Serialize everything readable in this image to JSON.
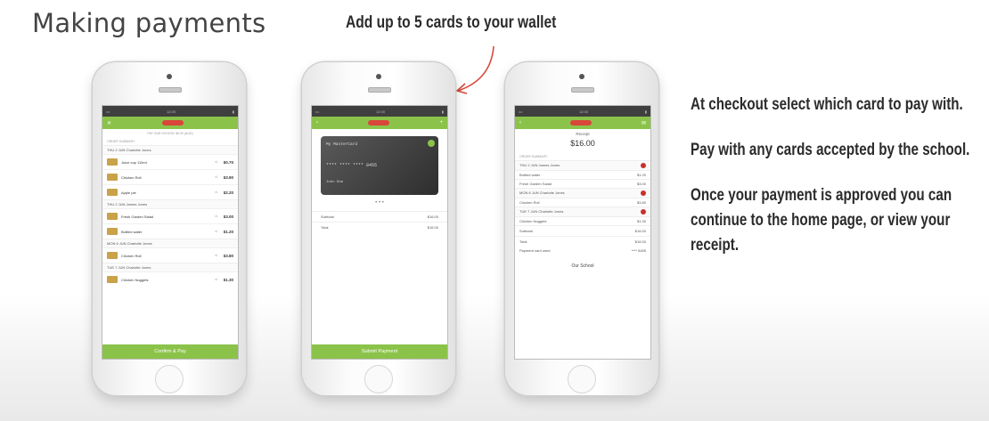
{
  "heading": "Making payments",
  "callout": "Add up to 5 cards to your wallet",
  "side_text": [
    "At checkout select which card to pay with.",
    "Pay with any cards accepted by the school.",
    "Once your payment is approved you can continue to the home page, or view your receipt."
  ],
  "phone1": {
    "subtitle": "PAY OUR SCHOOL $6.90 (AUD)",
    "section": "ORDER SUMMARY",
    "groups": [
      {
        "day": "THU 2 JUN  Charlotte Jones",
        "items": [
          {
            "name": "Juice cup 110ml",
            "qty": "x1",
            "price": "$0.70"
          },
          {
            "name": "Chicken Roll",
            "qty": "x1",
            "price": "$3.90"
          },
          {
            "name": "Apple pie",
            "qty": "x1",
            "price": "$2.20"
          }
        ]
      },
      {
        "day": "THU 2 JUN  James Jones",
        "items": [
          {
            "name": "Fresh Garden Salad",
            "qty": "x1",
            "price": "$3.00"
          },
          {
            "name": "Bottled water",
            "qty": "x1",
            "price": "$1.20"
          }
        ]
      },
      {
        "day": "MON 6 JUN  Charlotte Jones",
        "items": [
          {
            "name": "Chicken Roll",
            "qty": "x1",
            "price": "$3.80"
          }
        ]
      },
      {
        "day": "TUE 7 JUN  Charlotte Jones",
        "items": [
          {
            "name": "Chicken Nuggets",
            "qty": "x1",
            "price": "$1.30"
          }
        ]
      }
    ],
    "button": "Confirm & Pay"
  },
  "phone2": {
    "card_name": "My MasterCard",
    "card_number": "**** **** **** 8455",
    "card_holder": "John Doe",
    "rows": [
      {
        "label": "Subtotal",
        "value": "$16.00"
      },
      {
        "label": "Total",
        "value": "$16.00"
      }
    ],
    "button": "Submit Payment"
  },
  "phone3": {
    "receipt_label": "Receipt",
    "amount": "$16.00",
    "section": "ORDER SUMMARY",
    "lines": [
      {
        "day": "THU 2 JUN  James Jones"
      },
      {
        "name": "Bottled water",
        "price": "$1.20"
      },
      {
        "name": "Fresh Garden Salad",
        "price": "$3.00"
      },
      {
        "day": "MON 6 JUN  Charlotte Jones"
      },
      {
        "name": "Chicken Roll",
        "price": "$3.80"
      },
      {
        "day": "TUE 7 JUN  Charlotte Jones"
      },
      {
        "name": "Chicken Nuggets",
        "price": "$1.30"
      }
    ],
    "subtotal_label": "Subtotal",
    "subtotal": "$16.00",
    "total_label": "Total",
    "total": "$16.00",
    "payment_label": "Payment card used",
    "payment_value": "**** 8455",
    "school": "Our School"
  },
  "colors": {
    "accent": "#8bc34a",
    "remove": "#c9302c",
    "arrow": "#d9463a"
  }
}
